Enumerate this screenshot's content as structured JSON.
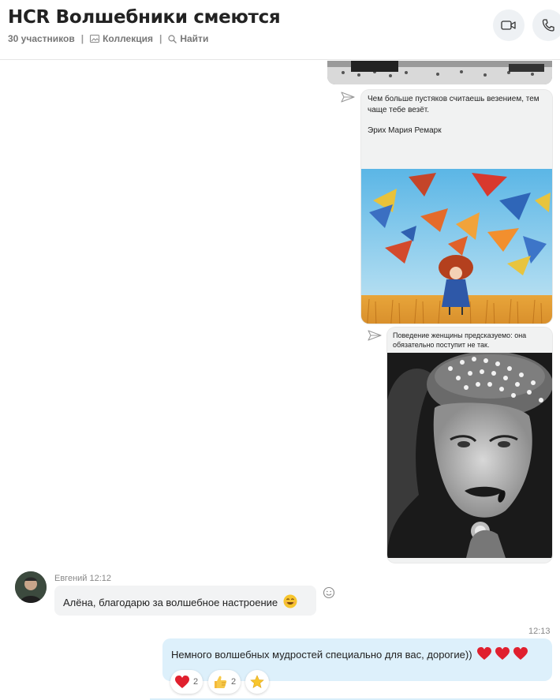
{
  "header": {
    "title": "HCR Волшебники смеются",
    "participants": "30 участников",
    "separator": "|",
    "collection": "Коллекция",
    "find": "Найти"
  },
  "messages": {
    "quote1": {
      "text": "Чем больше пустяков считаешь везением, тем чаще тебе везёт.",
      "author": "Эрих Мария Ремарк"
    },
    "quote2": {
      "text": "Поведение женщины предсказуемо: она обязательно поступит не так."
    },
    "incoming": {
      "sender": "Евгений",
      "time": "12:12",
      "text": "Алёна, благодарю за волшебное настроение"
    },
    "outgoing": {
      "time": "12:13",
      "text": "Немного волшебных мудростей специально для вас, дорогие))",
      "reactions": [
        {
          "emoji": "heart",
          "count": "2"
        },
        {
          "emoji": "thumbs-up",
          "count": "2"
        },
        {
          "emoji": "star",
          "count": ""
        }
      ]
    }
  },
  "colors": {
    "accent_bubble": "#ddf0fb",
    "incoming_bubble": "#f2f3f4",
    "heart": "#e0202e"
  }
}
